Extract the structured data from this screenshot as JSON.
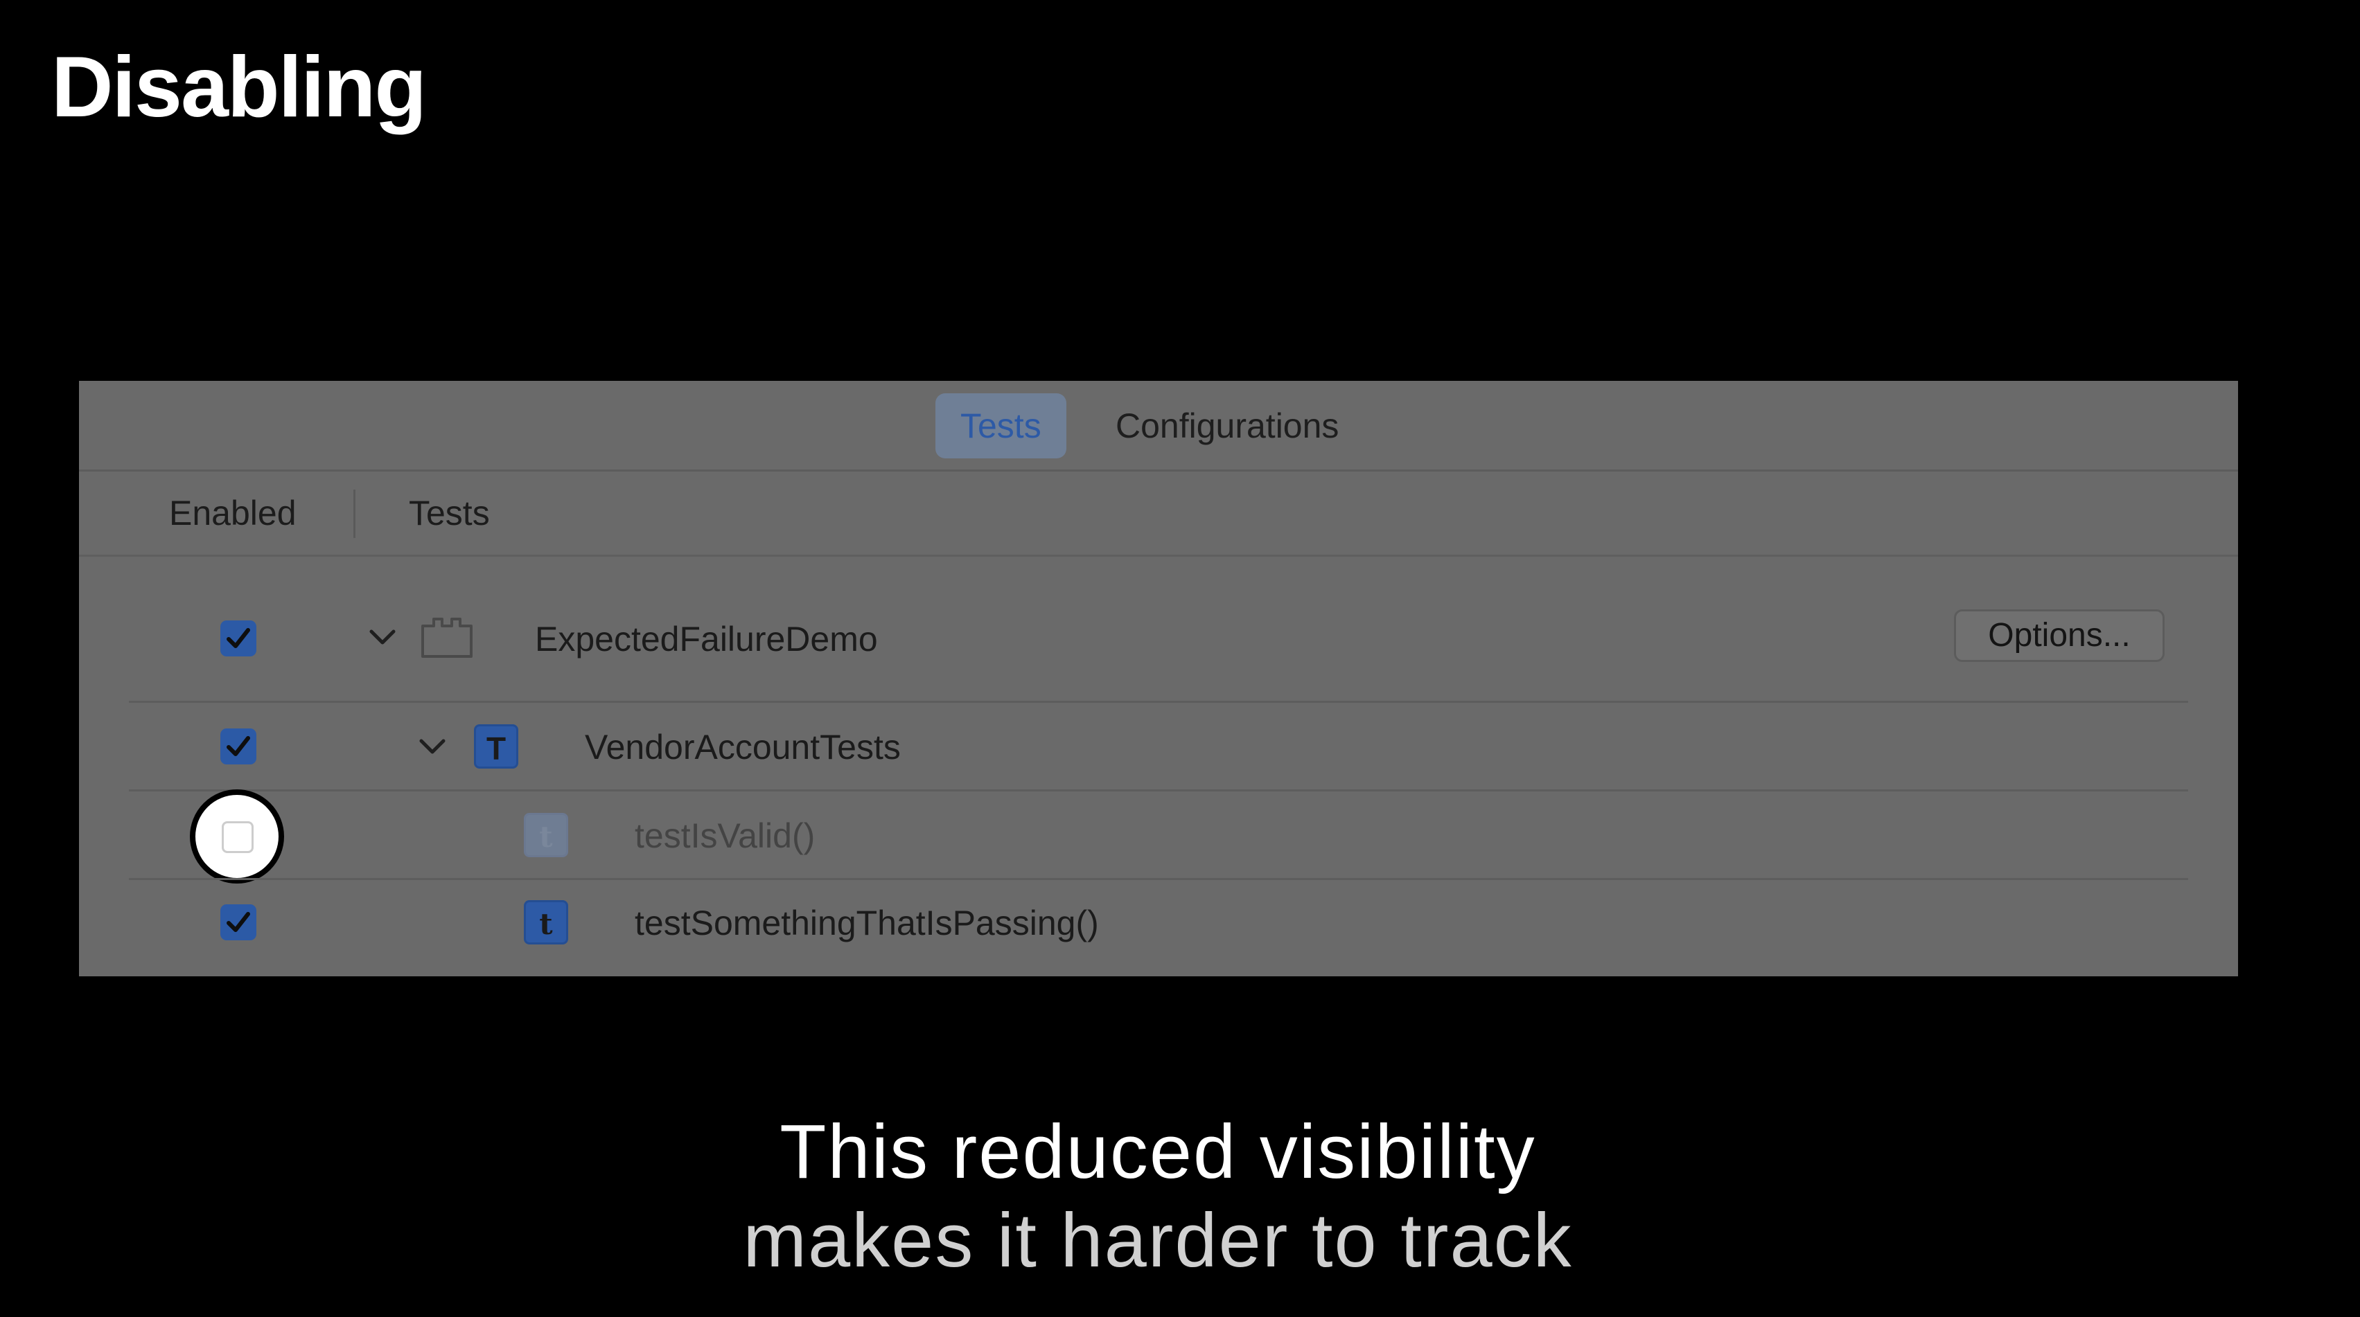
{
  "slide": {
    "title": "Disabling",
    "caption_line1": "This reduced visibility",
    "caption_line2": "makes it harder to track"
  },
  "tabs": {
    "tests_label": "Tests",
    "configurations_label": "Configurations"
  },
  "columns": {
    "enabled_label": "Enabled",
    "tests_label": "Tests"
  },
  "rows": [
    {
      "label": "ExpectedFailureDemo",
      "enabled": true,
      "kind": "target",
      "expanded": true
    },
    {
      "label": "VendorAccountTests",
      "enabled": true,
      "kind": "class",
      "badge": "T",
      "expanded": true
    },
    {
      "label": "testIsValid()",
      "enabled": false,
      "kind": "method",
      "badge": "t"
    },
    {
      "label": "testSomethingThatIsPassing()",
      "enabled": true,
      "kind": "method",
      "badge": "t"
    }
  ],
  "options_button": {
    "label": "Options..."
  },
  "colors": {
    "accent": "#2c5aa6",
    "panel_background": "#6a6a6a",
    "slide_background": "#000000"
  },
  "icons": {
    "checkmark": "checkmark-icon",
    "disclosure": "chevron-down-icon",
    "target": "folder-icon"
  }
}
